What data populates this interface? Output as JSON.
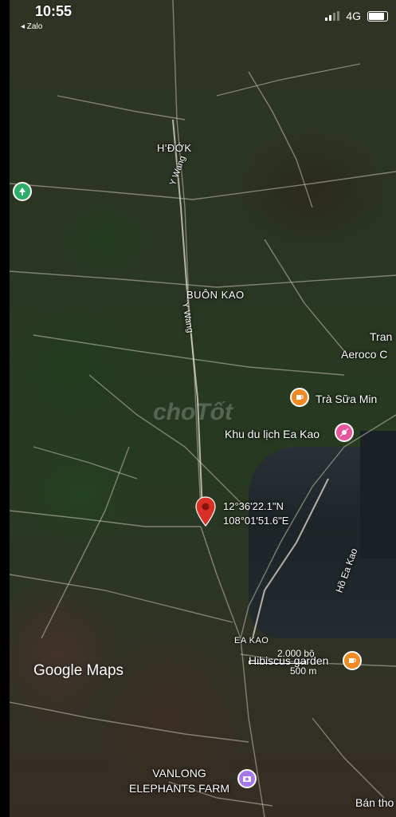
{
  "status_bar": {
    "time": "10:55",
    "back_label": "◂ Zalo",
    "network": "4G"
  },
  "map": {
    "places": [
      {
        "name": "H'ĐỚK"
      },
      {
        "name": "BUÔN KAO"
      },
      {
        "name": "EA KAO"
      }
    ],
    "roads": [
      {
        "name": "Y Wang"
      },
      {
        "name": "Y Wang"
      }
    ],
    "lake_label": "Hồ Ea Kao",
    "pois": [
      {
        "name": "Trà Sữa Min",
        "color": "#f08a24",
        "icon": "coffee-icon"
      },
      {
        "name": "Khu du lịch Ea Kao",
        "color": "#e8559c",
        "icon": "attraction-icon"
      },
      {
        "name": "Hibiscus garden",
        "color": "#f08a24",
        "icon": "coffee-icon"
      },
      {
        "name": "VANLONG ELEPHANTS FARM",
        "color": "#a678e8",
        "icon": "camera-icon"
      },
      {
        "name": "",
        "color": "#2fae6a",
        "icon": "park-icon"
      }
    ],
    "edge_labels": {
      "tran": "Tran",
      "aeroco": "Aeroco C",
      "ban_tho": "Bán tho"
    },
    "pin": {
      "lat": "12°36'22.1\"N",
      "lng": "108°01'51.6\"E",
      "color": "#d93025"
    },
    "scale_imperial": "2.000 bộ",
    "scale_metric": "500 m",
    "watermark": "choTốt",
    "logo": "Google Maps"
  }
}
